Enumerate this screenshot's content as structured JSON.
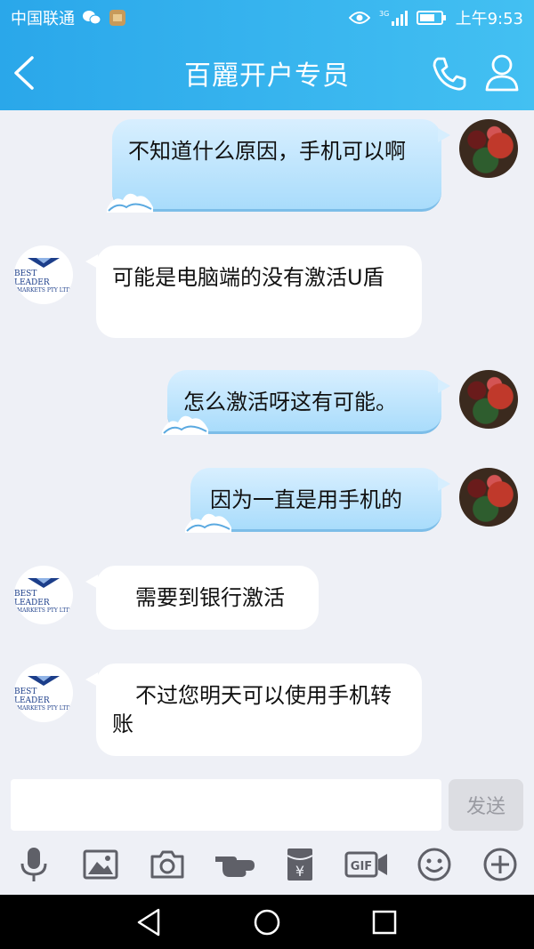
{
  "status_bar": {
    "carrier": "中国联通",
    "network": "3G",
    "time": "上午9:53"
  },
  "header": {
    "title": "百麗开户专员",
    "icons": [
      "back-arrow-icon",
      "phone-icon",
      "person-icon"
    ]
  },
  "contact_logo": {
    "line1": "BEST LEADER",
    "line2": "MARKETS PTY LTD"
  },
  "messages": [
    {
      "sender": "me",
      "text": "不知道什么原因，手机可以啊"
    },
    {
      "sender": "other",
      "text": "可能是电脑端的没有激活U盾"
    },
    {
      "sender": "me",
      "text": "怎么激活呀这有可能。"
    },
    {
      "sender": "me",
      "text": "因为一直是用手机的"
    },
    {
      "sender": "other",
      "text": "需要到银行激活"
    },
    {
      "sender": "other",
      "text": "不过您明天可以使用手机转账"
    }
  ],
  "input": {
    "value": "",
    "send_label": "发送"
  },
  "toolbar": [
    "microphone-icon",
    "image-icon",
    "camera-icon",
    "poke-icon",
    "red-packet-icon",
    "gif-icon",
    "emoji-icon",
    "plus-icon"
  ],
  "colors": {
    "header_start": "#2aa7ea",
    "header_end": "#43c0f2",
    "my_bubble": "#a9dcfb",
    "background": "#eef0f6"
  }
}
